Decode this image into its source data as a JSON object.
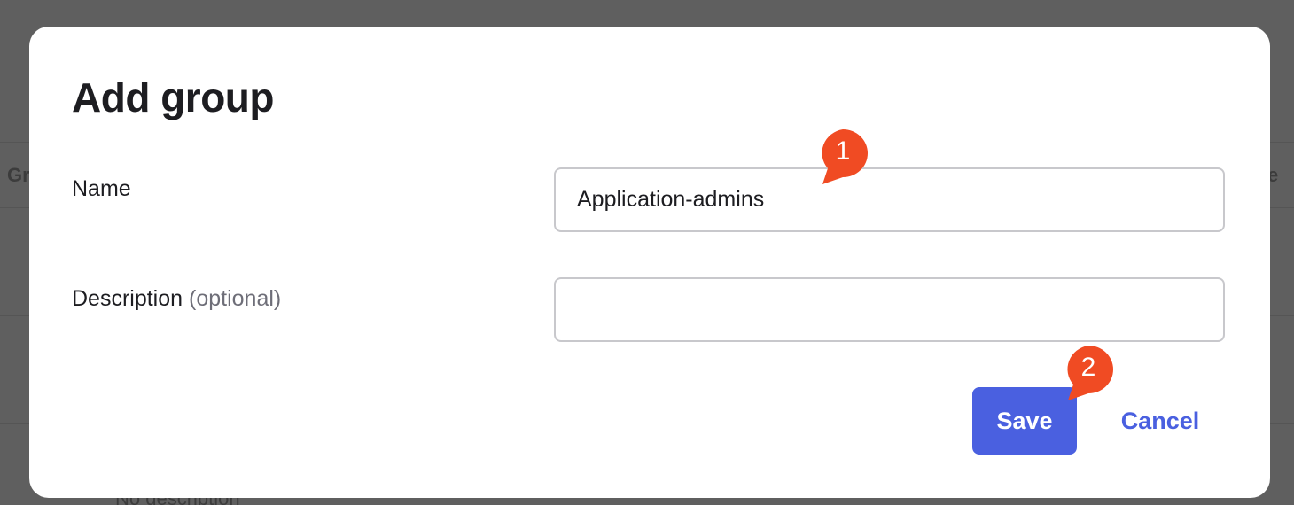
{
  "background": {
    "column_header_left": "Gr",
    "column_header_right": "e",
    "row_text": "No description"
  },
  "dialog": {
    "title": "Add group",
    "name_field": {
      "label": "Name",
      "value": "Application-admins",
      "placeholder": ""
    },
    "description_field": {
      "label": "Description",
      "optional_label": "(optional)",
      "value": "",
      "placeholder": ""
    },
    "save_label": "Save",
    "cancel_label": "Cancel"
  },
  "callouts": [
    {
      "number": "1",
      "color": "#f04b23"
    },
    {
      "number": "2",
      "color": "#f04b23"
    }
  ],
  "colors": {
    "accent": "#4a60e0",
    "callout": "#f04b23",
    "overlay": "#5e5e5e"
  }
}
